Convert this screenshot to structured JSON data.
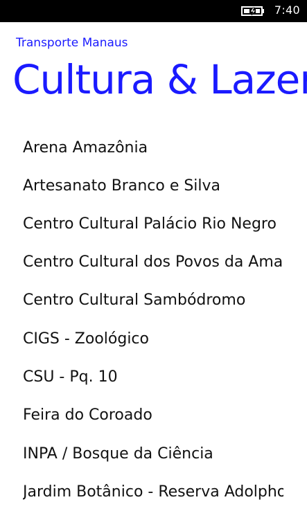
{
  "status_bar": {
    "time": "7:40",
    "battery_icon": "battery-charging-icon"
  },
  "header": {
    "app_title": "Transporte Manaus",
    "page_title": "Cultura & Lazer"
  },
  "colors": {
    "accent": "#1a1aff",
    "text": "#111111",
    "background": "#ffffff",
    "status_bar": "#000000"
  },
  "list": {
    "items": [
      {
        "label": "Arena Amazônia"
      },
      {
        "label": "Artesanato Branco e Silva"
      },
      {
        "label": "Centro Cultural Palácio Rio Negro"
      },
      {
        "label": "Centro Cultural dos Povos da Amazônia"
      },
      {
        "label": "Centro Cultural Sambódromo"
      },
      {
        "label": "CIGS - Zoológico"
      },
      {
        "label": "CSU - Pq. 10"
      },
      {
        "label": "Feira do Coroado"
      },
      {
        "label": "INPA / Bosque da Ciência"
      },
      {
        "label": "Jardim Botânico - Reserva Adolpho Ducke"
      }
    ]
  }
}
